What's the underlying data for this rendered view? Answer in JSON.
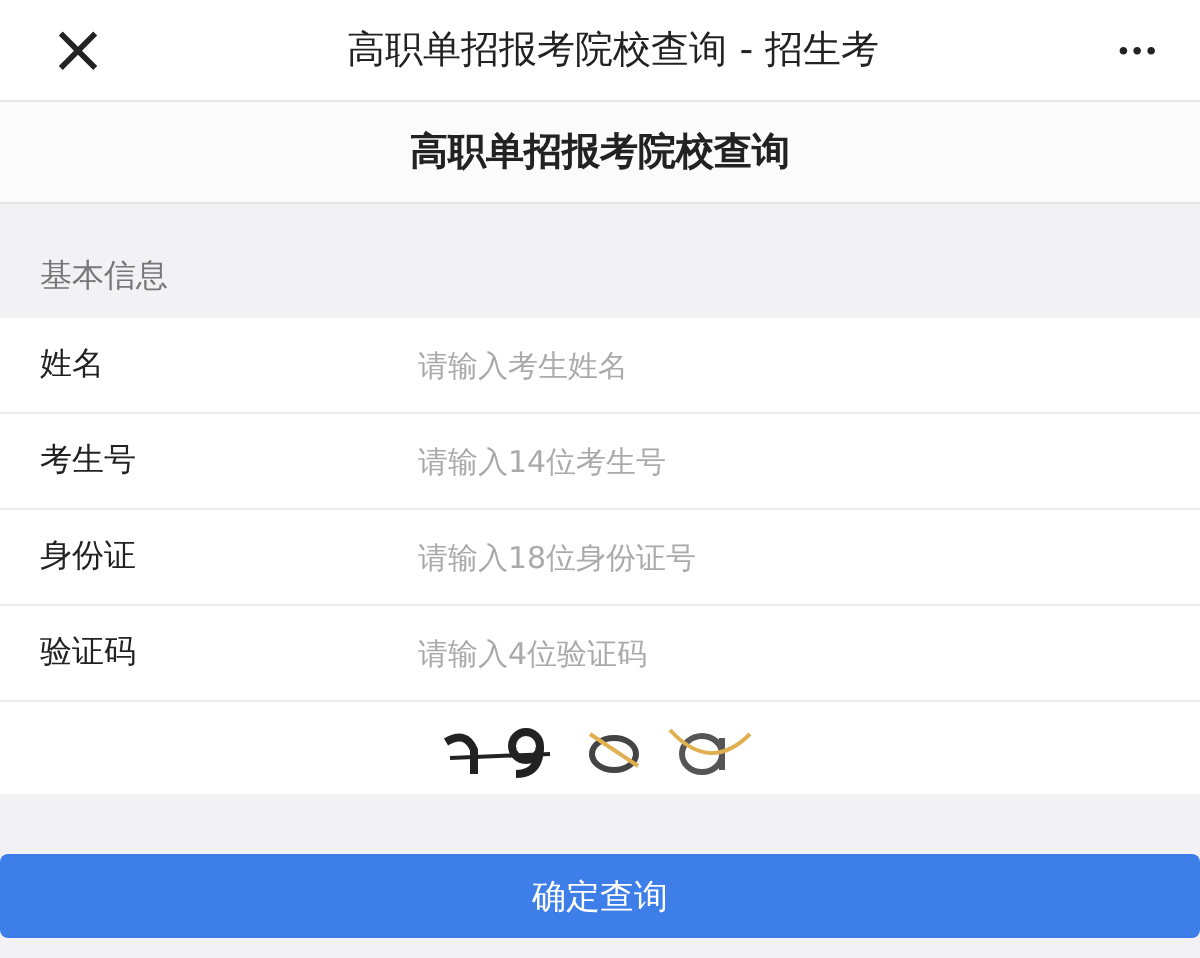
{
  "nav_bar": {
    "close": "×",
    "title": "高职单招报考院校查询 - 招生考",
    "more": "•••"
  },
  "page_title": "高职单招报考院校查询",
  "section_title": "基本信息",
  "fields": [
    {
      "label": "姓名",
      "placeholder": "请输入考生姓名"
    },
    {
      "label": "考生号",
      "placeholder": "请输入14位考生号"
    },
    {
      "label": "身份证",
      "placeholder": "请输入18位身份证号"
    },
    {
      "label": "验证码",
      "placeholder": "请输入4位验证码"
    }
  ],
  "submit_button": "确定查询"
}
